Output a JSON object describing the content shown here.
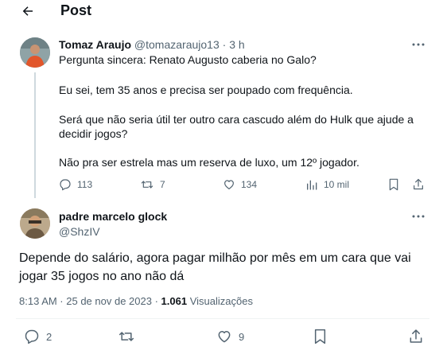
{
  "header": {
    "title": "Post"
  },
  "tweet": {
    "author_name": "Tomaz Araujo",
    "author_handle": "@tomazaraujo13",
    "separator": "·",
    "time": "3 h",
    "lines": [
      "Pergunta sincera: Renato Augusto caberia no Galo?",
      "Eu sei, tem 35 anos e precisa ser poupado com frequência.",
      "Será que não seria útil ter outro cara cascudo além do Hulk que ajude a",
      "decidir jogos?",
      "Não pra ser estrela mas um reserva de luxo, um 12º jogador."
    ],
    "replies": "113",
    "reposts": "7",
    "likes": "134",
    "views": "10 mil"
  },
  "reply": {
    "author_name": "padre marcelo glock",
    "author_handle": "@ShzIV",
    "lines": [
      "Depende do salário, agora pagar milhão por mês em um cara que vai",
      "jogar 35 jogos no ano não dá"
    ],
    "timestamp": "8:13 AM · 25 de nov de 2023 ·",
    "views_count": "1.061",
    "views_label": "Visualizações",
    "replies": "2",
    "likes": "9"
  }
}
